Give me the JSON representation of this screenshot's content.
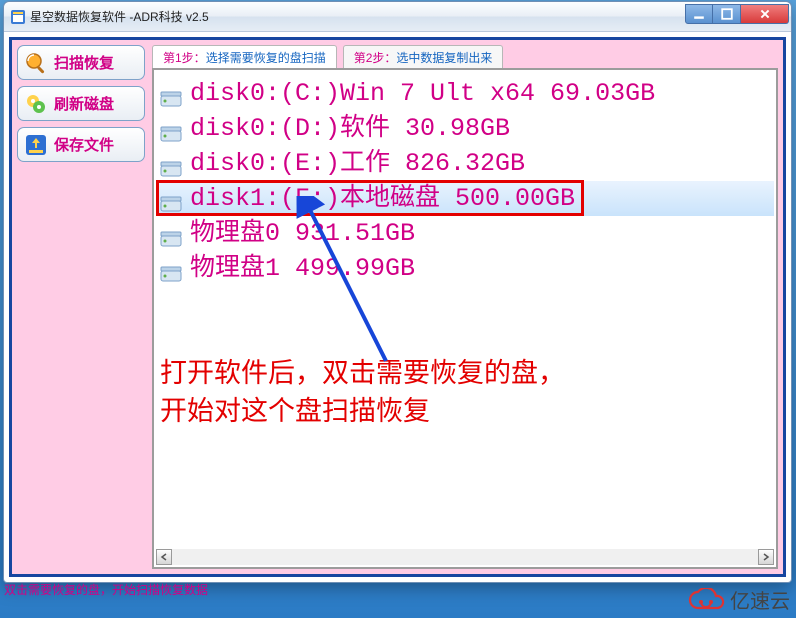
{
  "window": {
    "title": "星空数据恢复软件   -ADR科技 v2.5"
  },
  "sidebar": {
    "buttons": [
      {
        "label": "扫描恢复"
      },
      {
        "label": "刷新磁盘"
      },
      {
        "label": "保存文件"
      }
    ]
  },
  "tabs": {
    "step1_prefix": "第1步：",
    "step1_text": "选择需要恢复的盘扫描",
    "step2_prefix": "第2步：",
    "step2_text": "选中数据复制出来"
  },
  "disks": [
    {
      "text": "disk0:(C:)Win 7 Ult x64 69.03GB"
    },
    {
      "text": "disk0:(D:)软件 30.98GB"
    },
    {
      "text": "disk0:(E:)工作 826.32GB"
    },
    {
      "text": "disk1:(F:)本地磁盘 500.00GB"
    },
    {
      "text": "物理盘0 931.51GB"
    },
    {
      "text": "物理盘1 499.99GB"
    }
  ],
  "annotation": {
    "line1": "打开软件后，双击需要恢复的盘，",
    "line2": "开始对这个盘扫描恢复"
  },
  "statusbar": "双击需要恢复的盘，开始扫描恢复数据",
  "watermark": "亿速云"
}
